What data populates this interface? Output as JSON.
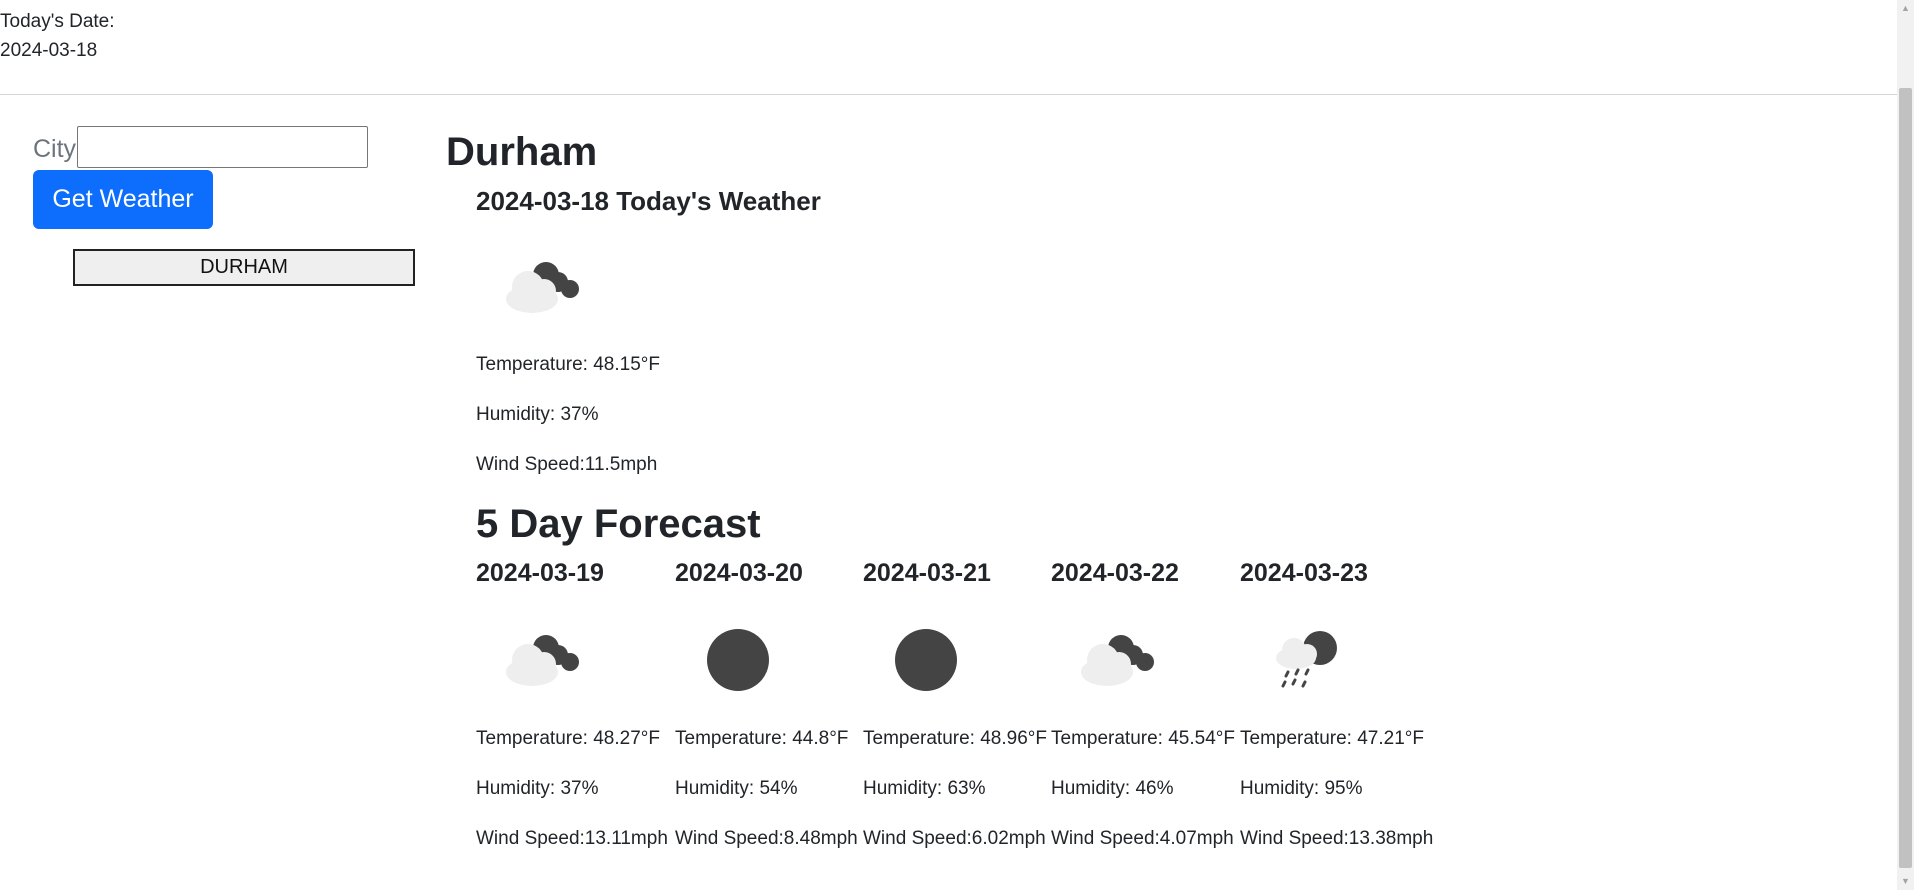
{
  "header": {
    "date_label": "Today's Date:",
    "date_value": "2024-03-18"
  },
  "search": {
    "city_label": "City:",
    "input_value": "",
    "button_label": "Get Weather",
    "history": [
      "DURHAM"
    ]
  },
  "current": {
    "city": "Durham",
    "heading": "2024-03-18 Today's Weather",
    "icon": "partly-cloudy-icon",
    "temperature": "Temperature: 48.15°F",
    "humidity": "Humidity: 37%",
    "wind": "Wind Speed:11.5mph"
  },
  "forecast": {
    "heading": "5 Day Forecast",
    "days": [
      {
        "date": "2024-03-19",
        "icon": "partly-cloudy-icon",
        "temperature": "Temperature: 48.27°F",
        "humidity": "Humidity: 37%",
        "wind": "Wind Speed:13.11mph"
      },
      {
        "date": "2024-03-20",
        "icon": "clear-icon",
        "temperature": "Temperature: 44.8°F",
        "humidity": "Humidity: 54%",
        "wind": "Wind Speed:8.48mph"
      },
      {
        "date": "2024-03-21",
        "icon": "clear-icon",
        "temperature": "Temperature: 48.96°F",
        "humidity": "Humidity: 63%",
        "wind": "Wind Speed:6.02mph"
      },
      {
        "date": "2024-03-22",
        "icon": "partly-cloudy-icon",
        "temperature": "Temperature: 45.54°F",
        "humidity": "Humidity: 46%",
        "wind": "Wind Speed:4.07mph"
      },
      {
        "date": "2024-03-23",
        "icon": "rain-icon",
        "temperature": "Temperature: 47.21°F",
        "humidity": "Humidity: 95%",
        "wind": "Wind Speed:13.38mph"
      }
    ]
  },
  "colors": {
    "accent": "#0d6efd",
    "text": "#212529",
    "icon_dark": "#444444",
    "icon_cloud": "#eeeeee"
  }
}
